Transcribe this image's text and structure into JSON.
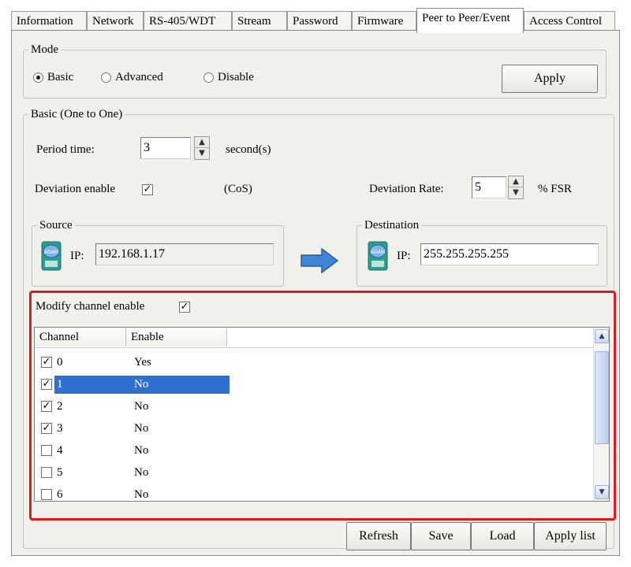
{
  "tabs": [
    {
      "label": "Information"
    },
    {
      "label": "Network"
    },
    {
      "label": "RS-405/WDT"
    },
    {
      "label": "Stream"
    },
    {
      "label": "Password"
    },
    {
      "label": "Firmware"
    },
    {
      "label": "Peer to Peer/Event",
      "active": true
    },
    {
      "label": "Access Control"
    }
  ],
  "mode": {
    "legend": "Mode",
    "options": [
      {
        "label": "Basic",
        "selected": true
      },
      {
        "label": "Advanced",
        "selected": false
      },
      {
        "label": "Disable",
        "selected": false
      }
    ],
    "apply_label": "Apply"
  },
  "basic": {
    "legend": "Basic (One to One)",
    "period_label": "Period time:",
    "period_value": "3",
    "period_unit": "second(s)",
    "deviation_enable_label": "Deviation enable",
    "deviation_enable_checked": true,
    "cos_label": "(CoS)",
    "deviation_rate_label": "Deviation Rate:",
    "deviation_rate_value": "5",
    "deviation_rate_unit": "% FSR",
    "source": {
      "legend": "Source",
      "ip_label": "IP:",
      "ip_value": "192.168.1.17"
    },
    "destination": {
      "legend": "Destination",
      "ip_label": "IP:",
      "ip_value": "255.255.255.255"
    }
  },
  "channels": {
    "modify_label": "Modify channel enable",
    "modify_checked": true,
    "columns": [
      "Channel",
      "Enable"
    ],
    "rows": [
      {
        "channel": "0",
        "enable": "Yes",
        "checked": true,
        "selected": false
      },
      {
        "channel": "1",
        "enable": "No",
        "checked": true,
        "selected": true
      },
      {
        "channel": "2",
        "enable": "No",
        "checked": true,
        "selected": false
      },
      {
        "channel": "3",
        "enable": "No",
        "checked": true,
        "selected": false
      },
      {
        "channel": "4",
        "enable": "No",
        "checked": false,
        "selected": false
      },
      {
        "channel": "5",
        "enable": "No",
        "checked": false,
        "selected": false
      },
      {
        "channel": "6",
        "enable": "No",
        "checked": false,
        "selected": false
      }
    ]
  },
  "buttons": {
    "refresh": "Refresh",
    "save": "Save",
    "load": "Load",
    "apply_list": "Apply list"
  },
  "colors": {
    "highlight_border": "#e01a1a",
    "selection": "#2f6fcf",
    "arrow": "#3f86d8"
  }
}
